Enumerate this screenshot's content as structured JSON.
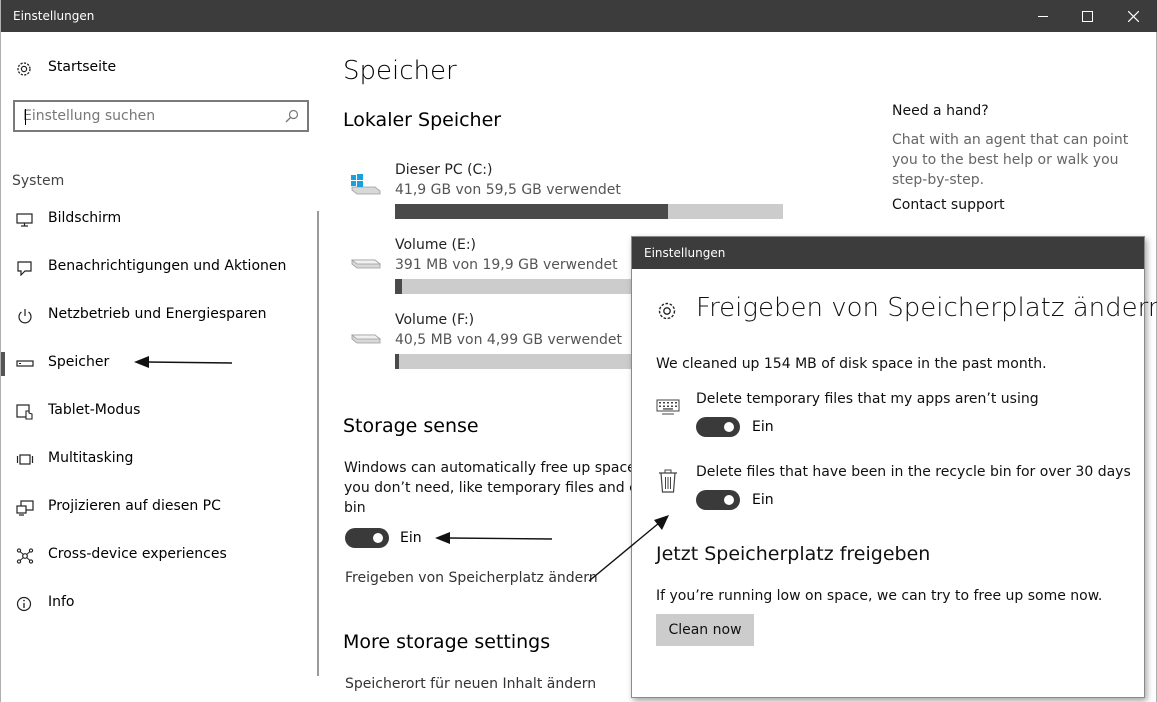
{
  "window": {
    "title": "Einstellungen"
  },
  "sidebar": {
    "home_label": "Startseite",
    "search_placeholder": "Einstellung suchen",
    "group_label": "System",
    "items": [
      {
        "label": "Bildschirm",
        "icon": "display-icon"
      },
      {
        "label": "Benachrichtigungen und Aktionen",
        "icon": "notifications-icon"
      },
      {
        "label": "Netzbetrieb und Energiesparen",
        "icon": "power-icon"
      },
      {
        "label": "Speicher",
        "icon": "storage-icon",
        "active": true
      },
      {
        "label": "Tablet-Modus",
        "icon": "tablet-mode-icon"
      },
      {
        "label": "Multitasking",
        "icon": "multitasking-icon"
      },
      {
        "label": "Projizieren auf diesen PC",
        "icon": "projecting-icon"
      },
      {
        "label": "Cross-device experiences",
        "icon": "cross-device-icon"
      },
      {
        "label": "Info",
        "icon": "info-icon"
      }
    ]
  },
  "main": {
    "title": "Speicher",
    "local_heading": "Lokaler Speicher",
    "drives": [
      {
        "name": "Dieser PC (C:)",
        "usage": "41,9 GB von 59,5 GB verwendet",
        "fraction": 0.704,
        "icon": "windows-drive-icon"
      },
      {
        "name": "Volume (E:)",
        "usage": "391 MB von 19,9 GB verwendet",
        "fraction": 0.0192,
        "icon": "drive-icon"
      },
      {
        "name": "Volume (F:)",
        "usage": "40,5 MB von 4,99 GB verwendet",
        "fraction": 0.0081,
        "icon": "drive-icon"
      }
    ],
    "storage_sense": {
      "heading": "Storage sense",
      "description_lines": [
        "Windows can automatically free up space by",
        "you don’t need, like temporary files and con",
        "bin"
      ],
      "toggle_label": "Ein",
      "link": "Freigeben von Speicherplatz ändern"
    },
    "more_heading": "More storage settings",
    "more_link": "Speicherort für neuen Inhalt ändern"
  },
  "help": {
    "title": "Need a hand?",
    "text": "Chat with an agent that can point you to the best help or walk you step-by-step.",
    "link": "Contact support"
  },
  "popup": {
    "title": "Einstellungen",
    "heading": "Freigeben von Speicherplatz ändern",
    "cleaned": "We cleaned up 154 MB of disk space in the past month.",
    "option1": {
      "label": "Delete temporary files that my apps aren’t using",
      "toggle": "Ein"
    },
    "option2": {
      "label": "Delete files that have been in the recycle bin for over 30 days",
      "toggle": "Ein"
    },
    "free_heading": "Jetzt Speicherplatz freigeben",
    "free_text": "If you’re running low on space, we can try to free up some now.",
    "clean_button": "Clean now"
  }
}
